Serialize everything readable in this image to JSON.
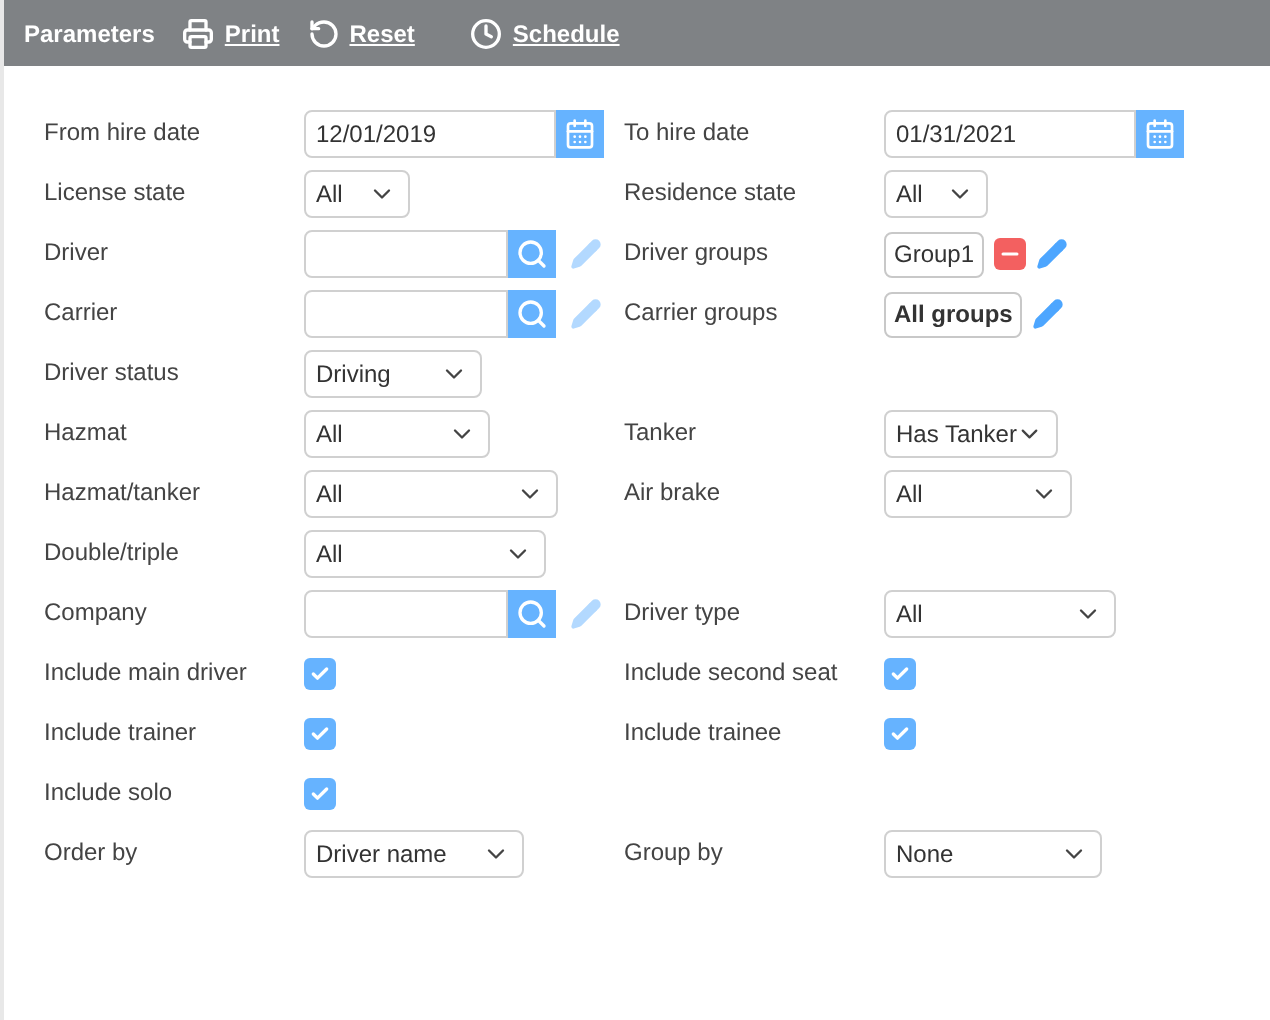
{
  "toolbar": {
    "title": "Parameters",
    "actions": [
      {
        "kind": "print",
        "label": "Print"
      },
      {
        "kind": "reset",
        "label": "Reset"
      },
      {
        "kind": "schedule",
        "label": "Schedule"
      }
    ]
  },
  "rows": [
    {
      "left": {
        "label": "From hire date",
        "kind": "date",
        "value": "12/01/2019"
      },
      "right": {
        "label": "To hire date",
        "kind": "date",
        "value": "01/31/2021"
      }
    },
    {
      "left": {
        "label": "License state",
        "kind": "select",
        "value": "All"
      },
      "right": {
        "label": "Residence state",
        "kind": "select",
        "value": "All"
      }
    },
    {
      "left": {
        "label": "Driver",
        "kind": "lookup"
      },
      "right": {
        "label": "Driver groups",
        "kind": "groups",
        "value": "Group1",
        "removable": true,
        "default": false
      }
    },
    {
      "left": {
        "label": "Carrier",
        "kind": "lookup"
      },
      "right": {
        "label": "Carrier groups",
        "kind": "groups",
        "value": "All groups",
        "removable": false,
        "default": true
      }
    },
    {
      "left": {
        "label": "Driver status",
        "kind": "select",
        "value": "Driving"
      }
    },
    {
      "left": {
        "label": "Hazmat",
        "kind": "select",
        "value": "All"
      },
      "right": {
        "label": "Tanker",
        "kind": "select",
        "value": "Has Tanker"
      }
    },
    {
      "left": {
        "label": "Hazmat/tanker",
        "kind": "select",
        "value": "All"
      },
      "right": {
        "label": "Air brake",
        "kind": "select",
        "value": "All"
      }
    },
    {
      "left": {
        "label": "Double/triple",
        "kind": "select",
        "value": "All"
      }
    },
    {
      "left": {
        "label": "Company",
        "kind": "lookup"
      },
      "right": {
        "label": "Driver type",
        "kind": "select",
        "value": "All"
      }
    },
    {
      "left": {
        "label": "Include main driver",
        "kind": "checkbox",
        "checked": true
      },
      "right": {
        "label": "Include second seat",
        "kind": "checkbox",
        "checked": true
      }
    },
    {
      "left": {
        "label": "Include trainer",
        "kind": "checkbox",
        "checked": true
      },
      "right": {
        "label": "Include trainee",
        "kind": "checkbox",
        "checked": true
      }
    },
    {
      "left": {
        "label": "Include solo",
        "kind": "checkbox",
        "checked": true
      }
    },
    {
      "left": {
        "label": "Order by",
        "kind": "select",
        "value": "Driver name"
      },
      "right": {
        "label": "Group by",
        "kind": "select",
        "value": "None"
      }
    }
  ]
}
